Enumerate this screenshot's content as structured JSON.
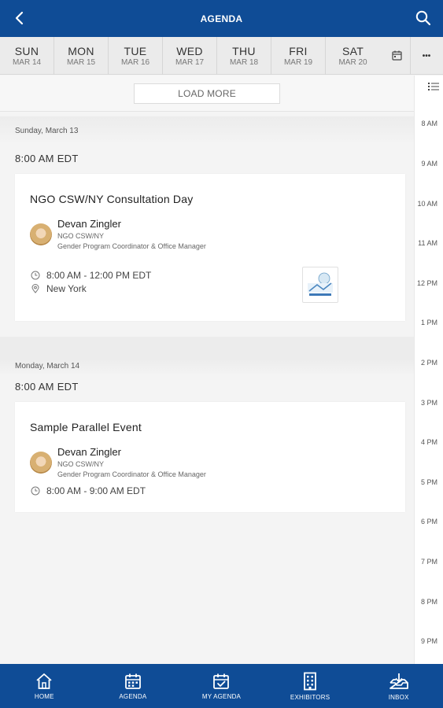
{
  "header": {
    "title": "AGENDA",
    "back_icon": "chevron-left-icon",
    "search_icon": "search-icon"
  },
  "days": [
    {
      "name": "SUN",
      "date": "MAR 14"
    },
    {
      "name": "MON",
      "date": "MAR 15"
    },
    {
      "name": "TUE",
      "date": "MAR 16"
    },
    {
      "name": "WED",
      "date": "MAR 17"
    },
    {
      "name": "THU",
      "date": "MAR 18"
    },
    {
      "name": "FRI",
      "date": "MAR 19"
    },
    {
      "name": "SAT",
      "date": "MAR 20"
    }
  ],
  "more_label": "•••",
  "load_more": "LOAD MORE",
  "sections": [
    {
      "day_label": "Sunday, March 13",
      "time_label": "8:00 AM EDT",
      "event": {
        "title": "NGO CSW/NY Consultation Day",
        "speaker": {
          "name": "Devan Zingler",
          "org": "NGO CSW/NY",
          "role": "Gender Program Coordinator & Office Manager"
        },
        "time": "8:00 AM - 12:00 PM EDT",
        "location": "New York"
      }
    },
    {
      "day_label": "Monday, March 14",
      "time_label": "8:00 AM EDT",
      "event": {
        "title": "Sample Parallel Event",
        "speaker": {
          "name": "Devan Zingler",
          "org": "NGO CSW/NY",
          "role": "Gender Program Coordinator & Office Manager"
        },
        "time": "8:00 AM - 9:00 AM EDT"
      }
    }
  ],
  "hours": [
    "8 AM",
    "9 AM",
    "10 AM",
    "11 AM",
    "12 PM",
    "1 PM",
    "2 PM",
    "3 PM",
    "4 PM",
    "5 PM",
    "6 PM",
    "7 PM",
    "8 PM",
    "9 PM"
  ],
  "bottom_nav": [
    {
      "label": "HOME",
      "icon": "home-icon"
    },
    {
      "label": "AGENDA",
      "icon": "calendar-icon"
    },
    {
      "label": "MY AGENDA",
      "icon": "calendar-check-icon"
    },
    {
      "label": "EXHIBITORS",
      "icon": "building-icon"
    },
    {
      "label": "INBOX",
      "icon": "inbox-icon"
    }
  ],
  "colors": {
    "brand": "#0f4c96",
    "background": "#f4f4f4"
  }
}
